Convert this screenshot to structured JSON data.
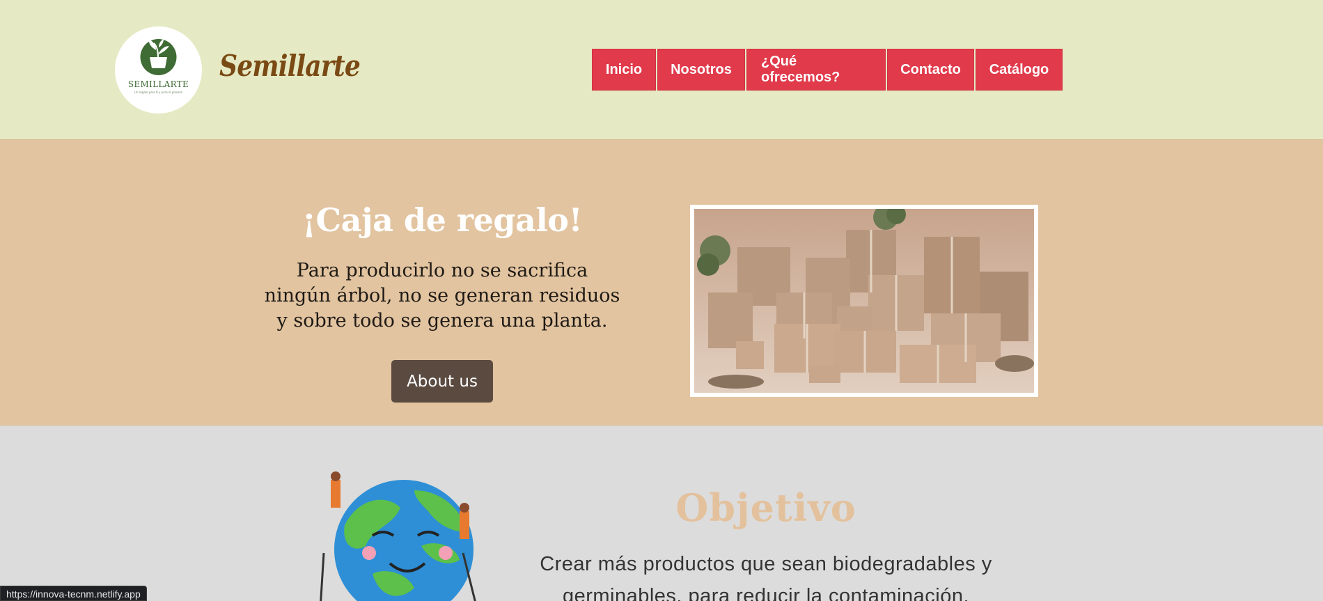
{
  "header": {
    "logo": {
      "name": "SEMILLARTE",
      "tagline": "Un regalo para ti y para el planeta"
    },
    "brand": "Semillarte",
    "nav": [
      "Inicio",
      "Nosotros",
      "¿Qué ofrecemos?",
      "Contacto",
      "Catálogo"
    ]
  },
  "hero": {
    "title": "¡Caja de regalo!",
    "text": "Para producirlo no se sacrifica ningún árbol, no se generan residuos y sobre todo se genera una planta.",
    "button": "About us",
    "image_alt": "gift-boxes-photo"
  },
  "objective": {
    "title": "Objetivo",
    "text": "Crear más productos que sean biodegradables y germinables, para reducir la contaminación."
  },
  "status_bar": {
    "url": "https://innova-tecnm.netlify.app"
  },
  "colors": {
    "header_bg": "#e6eac4",
    "hero_bg": "#e2c4a0",
    "section_bg": "#dcdcdc",
    "nav_bg": "#e03a4b",
    "brand": "#7a4a15",
    "button_bg": "#5a4a40",
    "objective_title": "#e3c19c"
  }
}
